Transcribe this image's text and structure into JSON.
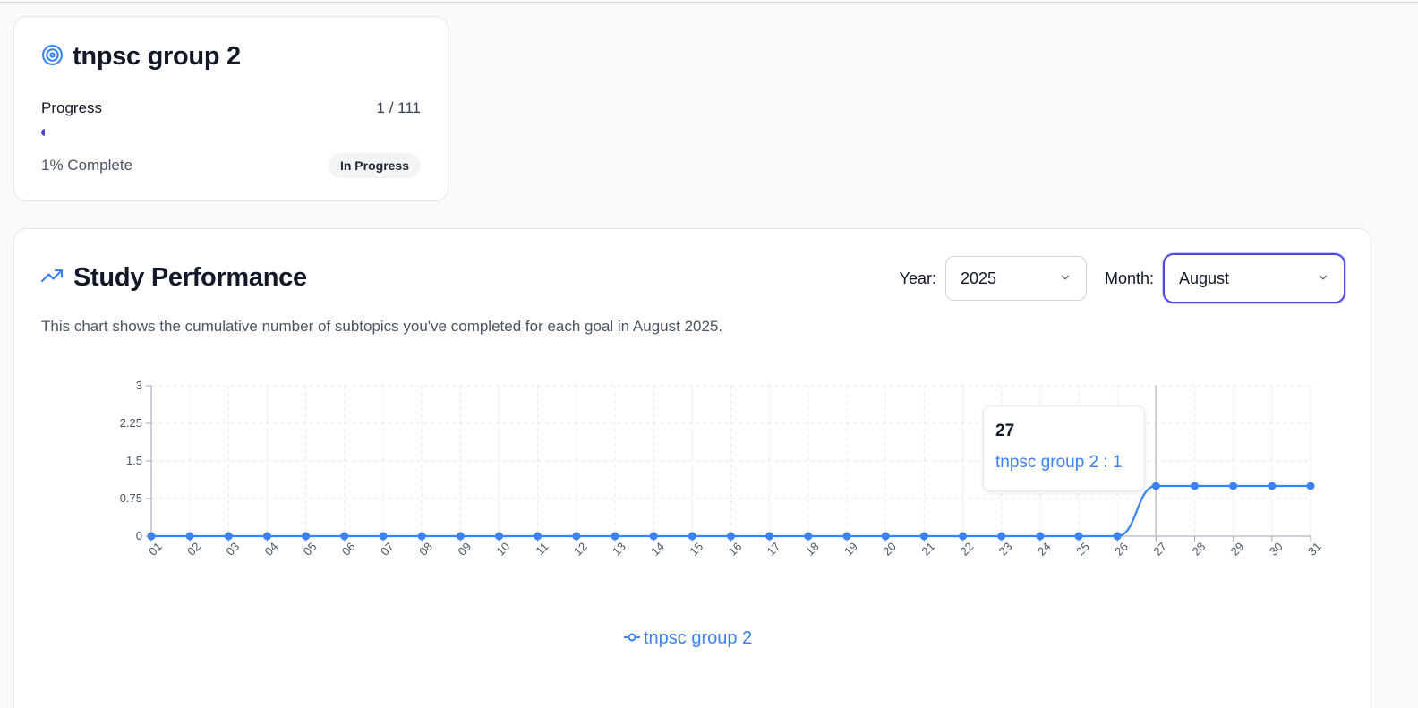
{
  "goal": {
    "title": "tnpsc group 2",
    "progress_label": "Progress",
    "progress_count": "1 / 111",
    "progress_fraction": 0.01,
    "complete_text": "1% Complete",
    "status_badge": "In Progress",
    "icon": "target-icon"
  },
  "performance": {
    "title": "Study Performance",
    "icon": "trending-up-icon",
    "year_label": "Year:",
    "year_value": "2025",
    "month_label": "Month:",
    "month_value": "August",
    "description": "This chart shows the cumulative number of subtopics you've completed for each goal in August 2025."
  },
  "tooltip": {
    "title": "27",
    "value_text": "tnpsc group 2 : 1"
  },
  "colors": {
    "accent": "#4f46e5",
    "series": "#3b82f6"
  },
  "chart_data": {
    "type": "line",
    "x": [
      "01",
      "02",
      "03",
      "04",
      "05",
      "06",
      "07",
      "08",
      "09",
      "10",
      "11",
      "12",
      "13",
      "14",
      "15",
      "16",
      "17",
      "18",
      "19",
      "20",
      "21",
      "22",
      "23",
      "24",
      "25",
      "26",
      "27",
      "28",
      "29",
      "30",
      "31"
    ],
    "y_ticks": [
      "0",
      "0.75",
      "1.5",
      "2.25",
      "3"
    ],
    "ylim": [
      0,
      3
    ],
    "grid": true,
    "legend_placement": "bottom-center",
    "series": [
      {
        "name": "tnpsc group 2",
        "values": [
          0,
          0,
          0,
          0,
          0,
          0,
          0,
          0,
          0,
          0,
          0,
          0,
          0,
          0,
          0,
          0,
          0,
          0,
          0,
          0,
          0,
          0,
          0,
          0,
          0,
          0,
          1,
          1,
          1,
          1,
          1
        ]
      }
    ],
    "highlight_x": "27"
  }
}
